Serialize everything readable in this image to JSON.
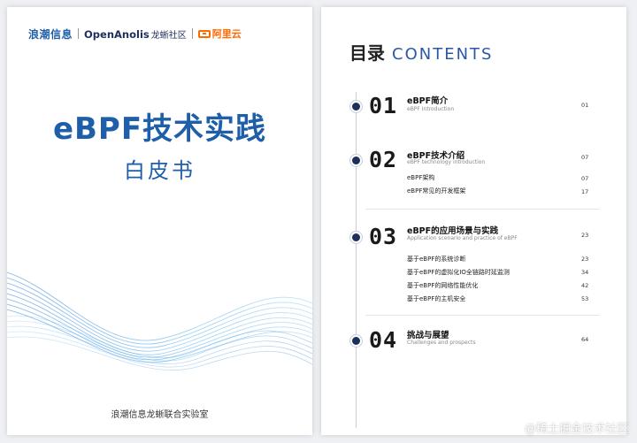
{
  "cover": {
    "logos": {
      "inspur": "浪潮信息",
      "openanolis": "OpenAnolis",
      "openanolis_cn": "龙蜥社区",
      "aliyun": "阿里云"
    },
    "title": "eBPF技术实践",
    "subtitle": "白皮书",
    "footer": "浪潮信息龙蜥联合实验室"
  },
  "toc": {
    "heading_cn": "目录",
    "heading_en": "CONTENTS",
    "sections": [
      {
        "num": "01",
        "title": "eBPF简介",
        "title_en": "eBPF Introduction",
        "page": "01",
        "items": []
      },
      {
        "num": "02",
        "title": "eBPF技术介绍",
        "title_en": "eBPF technology introduction",
        "page": "07",
        "items": [
          {
            "label": "eBPF架构",
            "page": "07"
          },
          {
            "label": "eBPF常见的开发框架",
            "page": "17"
          }
        ]
      },
      {
        "num": "03",
        "title": "eBPF的应用场景与实践",
        "title_en": "Application scenario and practice of eBPF",
        "page": "23",
        "items": [
          {
            "label": "基于eBPF的系统诊断",
            "page": "23"
          },
          {
            "label": "基于eBPF的虚拟化IO全链路时延监测",
            "page": "34"
          },
          {
            "label": "基于eBPF的网络性能优化",
            "page": "42"
          },
          {
            "label": "基于eBPF的主机安全",
            "page": "53"
          }
        ]
      },
      {
        "num": "04",
        "title": "挑战与展望",
        "title_en": "Challenges and prospects",
        "page": "64",
        "items": []
      }
    ]
  },
  "watermark": "@稀土掘金技术社区",
  "colors": {
    "brand_blue": "#1f5ea8",
    "aliyun_orange": "#ff6a00",
    "dark_navy": "#1d2f5c"
  }
}
